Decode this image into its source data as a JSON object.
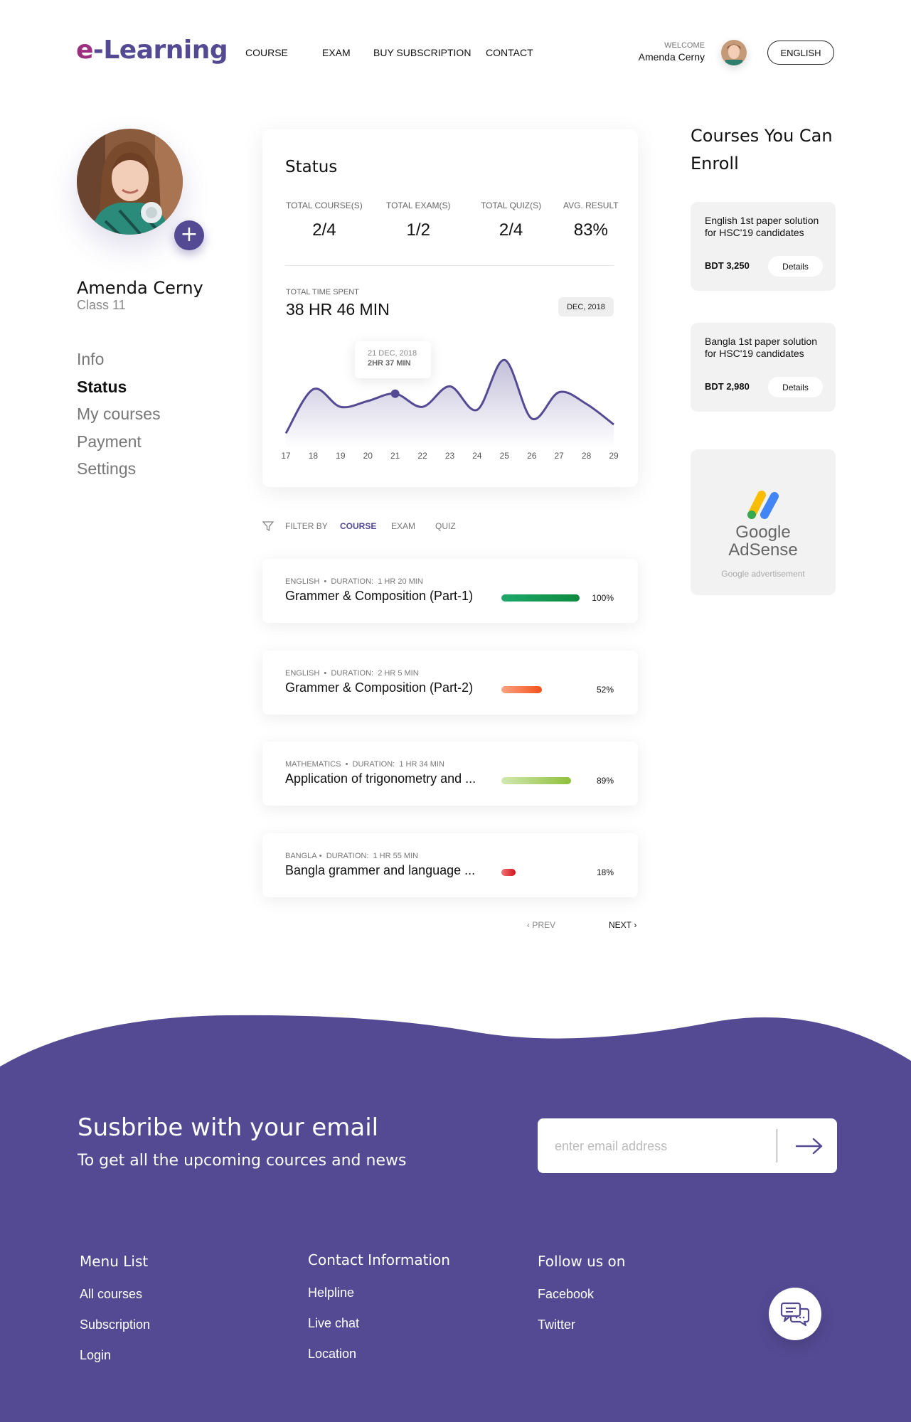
{
  "header": {
    "logo_e": "e",
    "logo_rest": "-Learning",
    "nav": [
      "COURSE",
      "EXAM",
      "BUY SUBSCRIPTION",
      "CONTACT"
    ],
    "welcome_label": "WELCOME",
    "user_name": "Amenda Cerny",
    "language_button": "ENGLISH"
  },
  "profile": {
    "name": "Amenda Cerny",
    "class": "Class 11",
    "add_label": "+",
    "menu": [
      "Info",
      "Status",
      "My courses",
      "Payment",
      "Settings"
    ],
    "active_menu": "Status"
  },
  "status": {
    "title": "Status",
    "stats": [
      {
        "label": "TOTAL COURSE(S)",
        "value": "2/4"
      },
      {
        "label": "TOTAL EXAM(S)",
        "value": "1/2"
      },
      {
        "label": "TOTAL QUIZ(S)",
        "value": "2/4"
      },
      {
        "label": "AVG. RESULT",
        "value": "83%"
      }
    ],
    "time_label": "TOTAL TIME SPENT",
    "time_value": "38 HR 46 MIN",
    "month_badge": "DEC, 2018",
    "tooltip_date": "21 DEC, 2018",
    "tooltip_time": "2HR 37 MIN",
    "accent": "#544a94"
  },
  "chart_data": {
    "type": "area",
    "x": [
      17,
      18,
      19,
      20,
      21,
      22,
      23,
      24,
      25,
      26,
      27,
      28,
      29
    ],
    "y": [
      0.5,
      2.0,
      1.4,
      1.6,
      1.85,
      1.4,
      2.1,
      1.3,
      3.0,
      1.0,
      1.9,
      1.5,
      0.8
    ],
    "highlight": {
      "x": 21,
      "label_date": "21 DEC, 2018",
      "label_value": "2HR 37 MIN"
    },
    "title": "",
    "xlabel": "",
    "ylabel": "",
    "grid": false
  },
  "filter": {
    "label": "FILTER BY",
    "options": [
      "COURSE",
      "EXAM",
      "QUIZ"
    ],
    "active": "COURSE"
  },
  "courses": [
    {
      "subject": "ENGLISH",
      "sep": "•",
      "duration_label": "DURATION:",
      "duration": "1 HR 20 MIN",
      "title": "Grammer & Composition (Part-1)",
      "progress": 100,
      "percent": "100%",
      "color_start": "#1ea86b",
      "color_end": "#0d8a3f"
    },
    {
      "subject": "ENGLISH",
      "sep": "•",
      "duration_label": "DURATION:",
      "duration": "2 HR 5 MIN",
      "title": "Grammer & Composition (Part-2)",
      "progress": 52,
      "percent": "52%",
      "color_start": "#ffa380",
      "color_end": "#f2521c"
    },
    {
      "subject": "MATHEMATICS",
      "sep": "•",
      "duration_label": "DURATION:",
      "duration": "1 HR 34 MIN",
      "title": "Application of trigonometry and ...",
      "progress": 89,
      "percent": "89%",
      "color_start": "#d2e8b0",
      "color_end": "#8fc03c"
    },
    {
      "subject": "BANGLA",
      "sep": "•",
      "duration_label": "DURATION:",
      "duration": "1 HR 55 MIN",
      "title": "Bangla grammer and language ...",
      "progress": 18,
      "percent": "18%",
      "color_start": "#f37777",
      "color_end": "#d0121b"
    }
  ],
  "pagination": {
    "prev": "PREV",
    "next": "NEXT"
  },
  "enroll": {
    "title": "Courses You Can Enroll",
    "cards": [
      {
        "desc": "English 1st paper solution for HSC'19 candidates",
        "price": "BDT 3,250",
        "button": "Details"
      },
      {
        "desc": "Bangla 1st paper solution for HSC'19 candidates",
        "price": "BDT 2,980",
        "button": "Details"
      }
    ],
    "ad_brand_line1": "Google",
    "ad_brand_line2": "AdSense",
    "ad_caption": "Google advertisement"
  },
  "footer": {
    "subscribe_title": "Susbribe with your email",
    "subscribe_sub": "To get all the upcoming cources and news",
    "email_placeholder": "enter email address",
    "columns": [
      {
        "heading": "Menu List",
        "links": [
          "All courses",
          "Subscription",
          "Login"
        ]
      },
      {
        "heading": "Contact Information",
        "links": [
          "Helpline",
          "Live chat",
          "Location"
        ]
      },
      {
        "heading": "Follow us on",
        "links": [
          "Facebook",
          "Twitter"
        ]
      }
    ],
    "bg_color": "#544a94"
  }
}
